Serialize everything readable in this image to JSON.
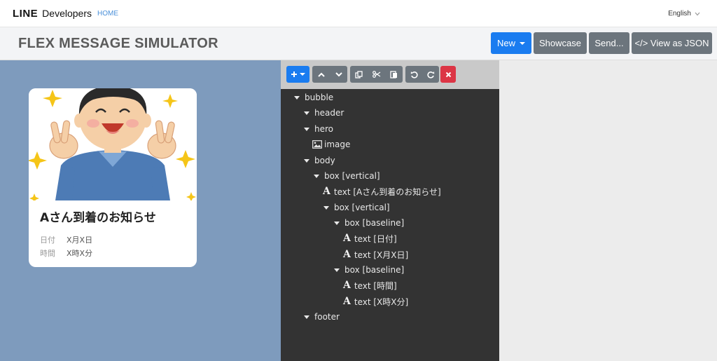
{
  "nav": {
    "brand_line": "LINE",
    "brand_developers": "Developers",
    "home": "HOME",
    "language": "English"
  },
  "header": {
    "title": "FLEX MESSAGE SIMULATOR",
    "buttons": {
      "new": "New",
      "showcase": "Showcase",
      "send": "Send...",
      "view_json": "</> View as JSON"
    }
  },
  "preview": {
    "card_title": "Aさん到着のお知らせ",
    "rows": [
      {
        "label": "日付",
        "value": "X月X日"
      },
      {
        "label": "時間",
        "value": "X時X分"
      }
    ]
  },
  "tree": [
    {
      "label": "bubble",
      "type": "node"
    },
    {
      "label": "header",
      "type": "node"
    },
    {
      "label": "hero",
      "type": "node"
    },
    {
      "label": "image",
      "type": "image"
    },
    {
      "label": "body",
      "type": "node"
    },
    {
      "label": "box [vertical]",
      "type": "node"
    },
    {
      "label": "text [Aさん到着のお知らせ]",
      "type": "text"
    },
    {
      "label": "box [vertical]",
      "type": "node"
    },
    {
      "label": "box [baseline]",
      "type": "node"
    },
    {
      "label": "text [日付]",
      "type": "text"
    },
    {
      "label": "text [X月X日]",
      "type": "text"
    },
    {
      "label": "box [baseline]",
      "type": "node"
    },
    {
      "label": "text [時間]",
      "type": "text"
    },
    {
      "label": "text [X時X分]",
      "type": "text"
    },
    {
      "label": "footer",
      "type": "node"
    }
  ],
  "colors": {
    "primary": "#1a7cf0",
    "secondary": "#6c757d",
    "danger": "#dc3545",
    "preview_bg": "#7e9bbd",
    "editor_bg": "#333333"
  },
  "icons": [
    "plus-icon",
    "chevron-up-icon",
    "chevron-down-icon",
    "copy-icon",
    "cut-icon",
    "paste-icon",
    "undo-icon",
    "redo-icon",
    "close-icon",
    "image-icon",
    "text-icon",
    "caret-down-icon"
  ]
}
